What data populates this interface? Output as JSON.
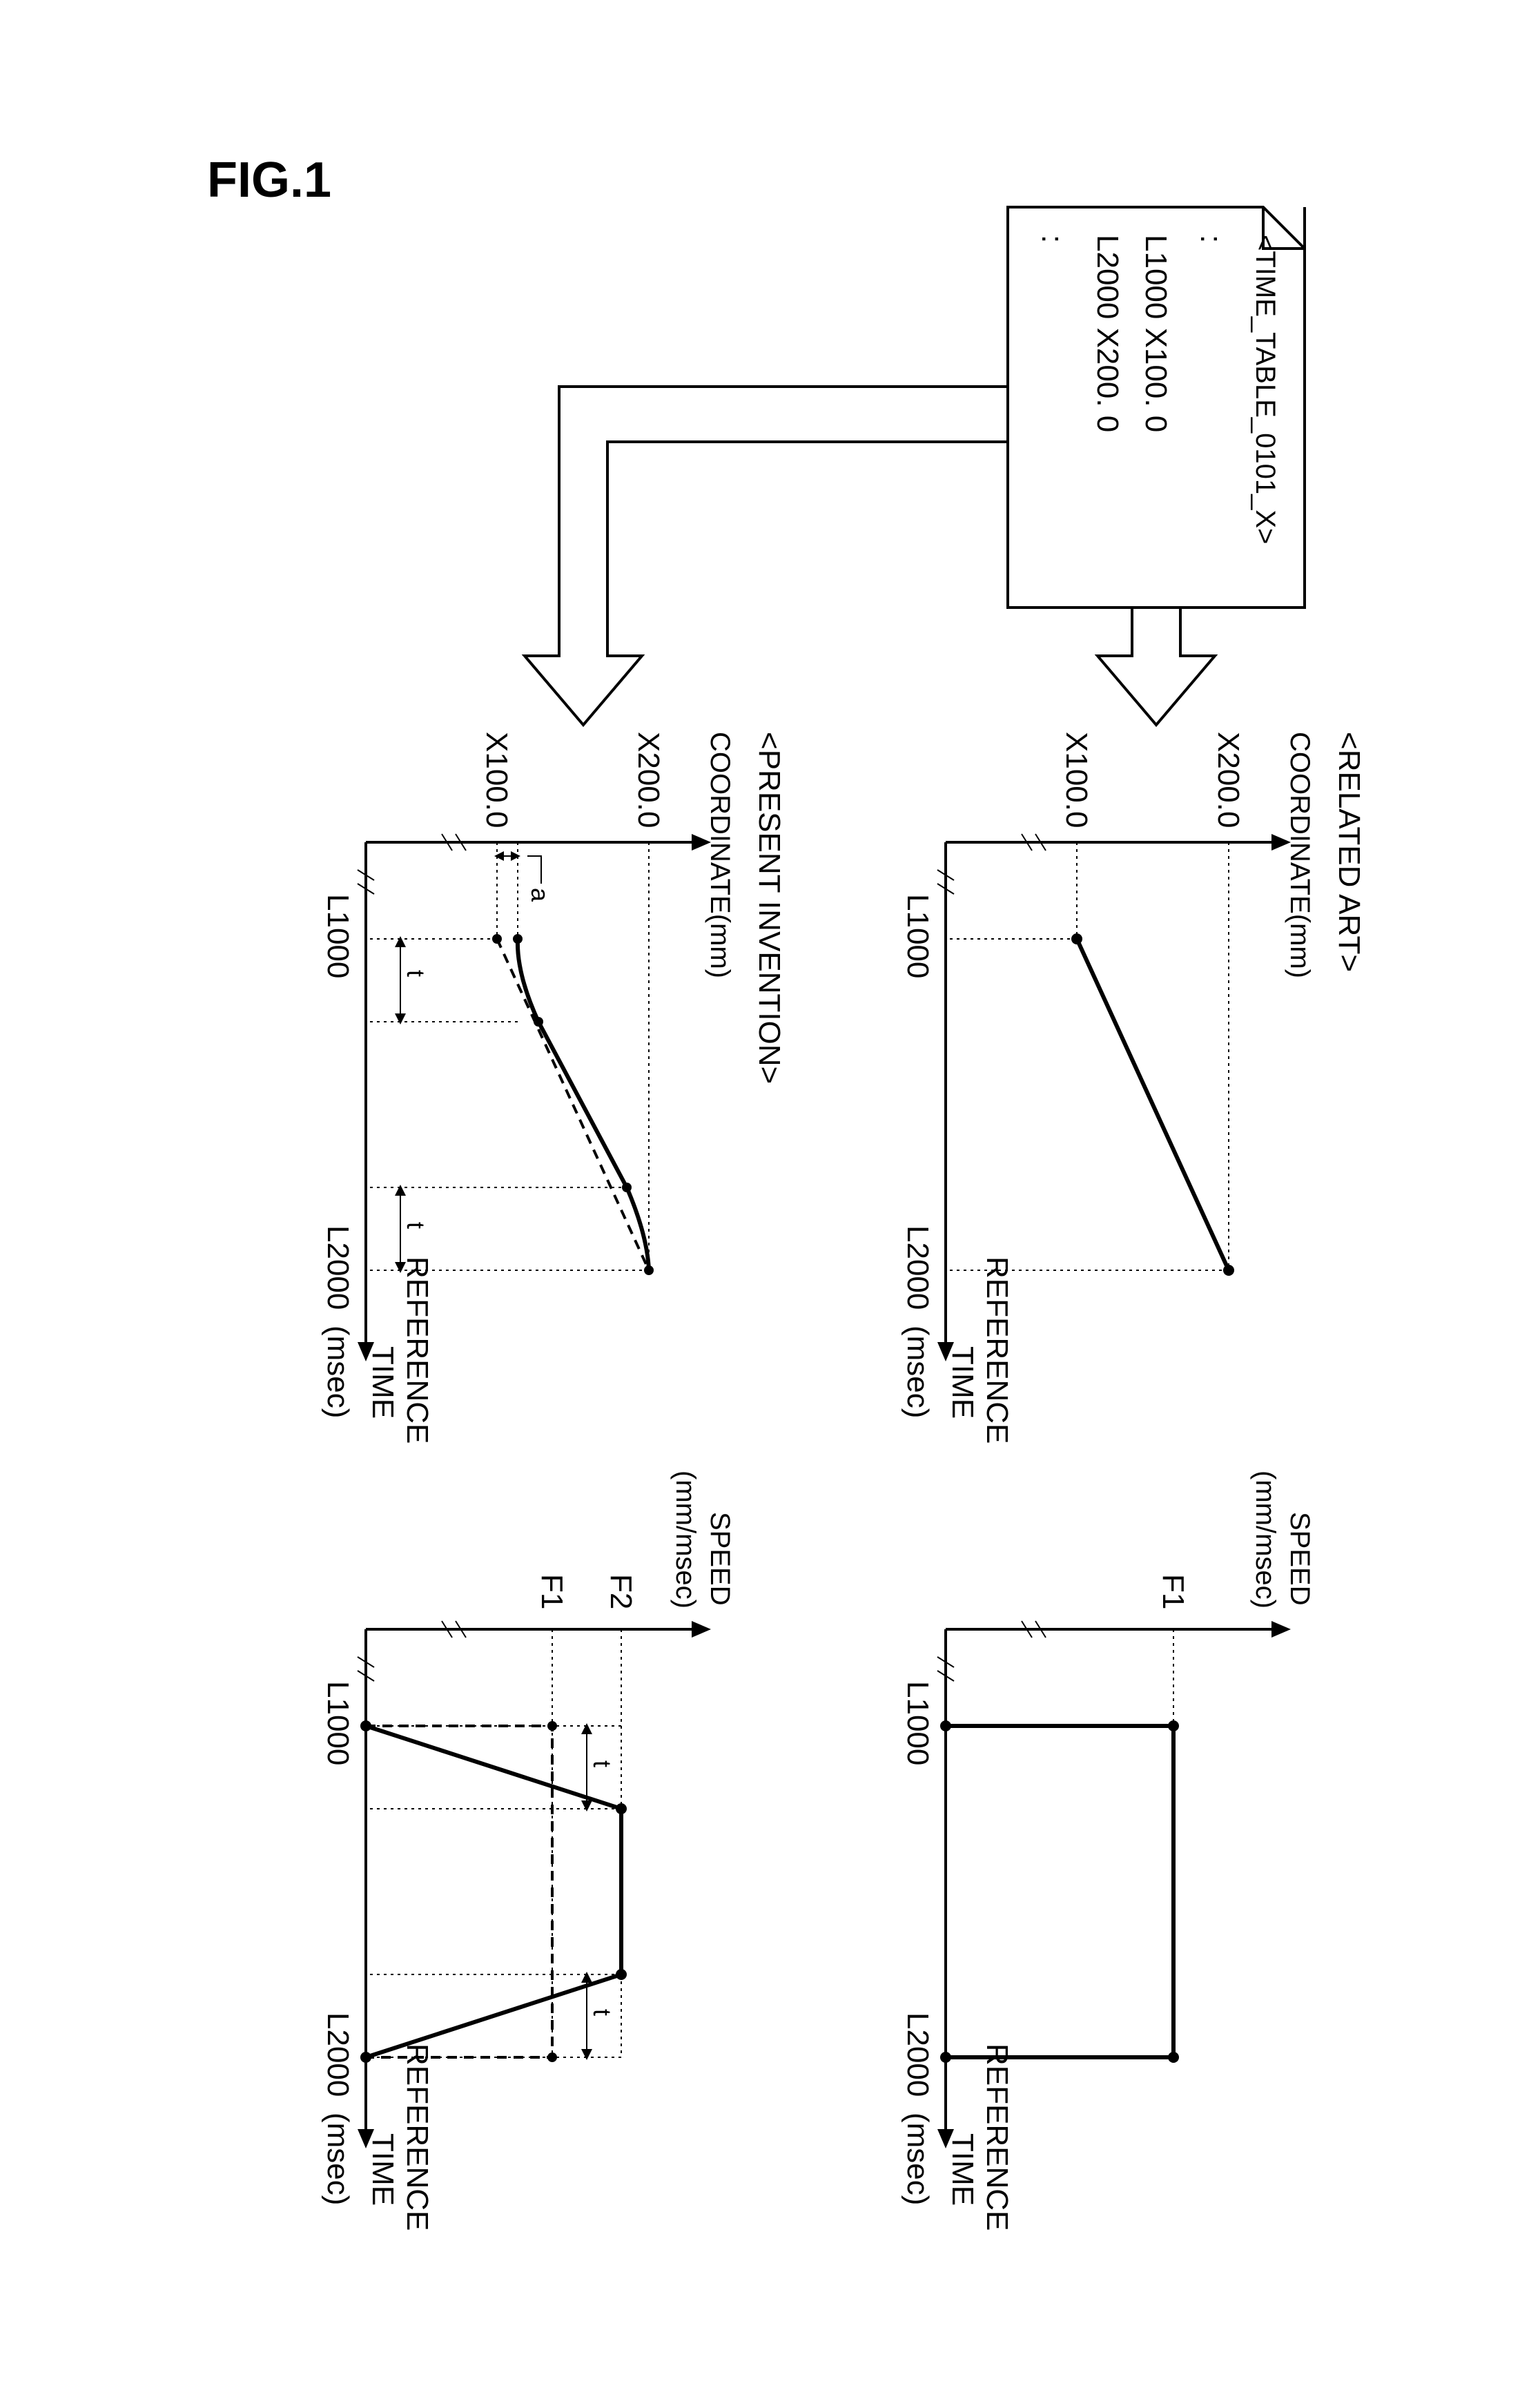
{
  "figure_label": "FIG.1",
  "section_related_art": "<RELATED ART>",
  "section_present_invention": "<PRESENT INVENTION>",
  "time_table": {
    "title": "<TIME_TABLE_0101_X>",
    "marker_top": ":",
    "row1": "L1000 X100. 0",
    "row2": "L2000 X200. 0",
    "marker_bot": ":"
  },
  "labels": {
    "coordinate": "COORDINATE(mm)",
    "speed1": "SPEED",
    "speed2": "(mm/msec)",
    "ref_time1": "REFERENCE",
    "ref_time2": "TIME",
    "msec": "(msec)",
    "x200": "X200.0",
    "x100": "X100.0",
    "l1000": "L1000",
    "l2000": "L2000",
    "f1": "F1",
    "f2": "F2",
    "a": "a",
    "t": "t"
  },
  "chart_data": [
    {
      "id": "related-art-coordinate",
      "type": "line",
      "title": "",
      "xlabel": "REFERENCE TIME (msec)",
      "ylabel": "COORDINATE (mm)",
      "x": [
        1000,
        2000
      ],
      "y": [
        100.0,
        200.0
      ],
      "y_ticks": [
        "X100.0",
        "X200.0"
      ],
      "x_ticks": [
        "L1000",
        "L2000"
      ],
      "note": "Straight line from (L1000,X100.0) to (L2000,X200.0).",
      "axis_break": true
    },
    {
      "id": "related-art-speed",
      "type": "line",
      "title": "",
      "xlabel": "REFERENCE TIME (msec)",
      "ylabel": "SPEED (mm/msec)",
      "x": [
        1000,
        1000,
        2000,
        2000
      ],
      "y": [
        0,
        "F1",
        "F1",
        0
      ],
      "y_ticks": [
        "F1"
      ],
      "x_ticks": [
        "L1000",
        "L2000"
      ],
      "note": "Rectangular pulse: speed=F1 between L1000 and L2000, 0 elsewhere.",
      "axis_break": true
    },
    {
      "id": "present-invention-coordinate",
      "type": "line",
      "title": "",
      "xlabel": "REFERENCE TIME (msec)",
      "ylabel": "COORDINATE (mm)",
      "y_ticks": [
        "X100.0",
        "X200.0"
      ],
      "x_ticks": [
        "L1000",
        "L2000"
      ],
      "series": [
        {
          "name": "original(dashed)",
          "x": [
            1000,
            2000
          ],
          "y": [
            100.0,
            200.0
          ]
        },
        {
          "name": "smoothed(solid)",
          "x": [
            1000,
            "1000+t",
            "2000-t",
            2000
          ],
          "y": [
            "100.0+a",
            "~",
            "~",
            200.0
          ],
          "note": "Smoothed S-curve offset from original by amount 'a' near start; transitions occur over duration t at each end."
        }
      ],
      "annotations": [
        "a",
        "t",
        "t"
      ],
      "axis_break": true
    },
    {
      "id": "present-invention-speed",
      "type": "line",
      "title": "",
      "xlabel": "REFERENCE TIME (msec)",
      "ylabel": "SPEED (mm/msec)",
      "y_ticks": [
        "F1",
        "F2"
      ],
      "x_ticks": [
        "L1000",
        "L2000"
      ],
      "series": [
        {
          "name": "original(dashed)",
          "x": [
            1000,
            1000,
            2000,
            2000
          ],
          "y": [
            0,
            "F1",
            "F1",
            0
          ]
        },
        {
          "name": "smoothed(solid)",
          "x": [
            1000,
            "1000+t",
            "2000-t",
            2000
          ],
          "y": [
            0,
            "F2",
            "F2",
            0
          ],
          "note": "Trapezoidal profile: ramps 0→F2 over t, holds F2, ramps F2→0 over t. F2>F1."
        }
      ],
      "annotations": [
        "t",
        "t"
      ],
      "axis_break": true
    }
  ]
}
